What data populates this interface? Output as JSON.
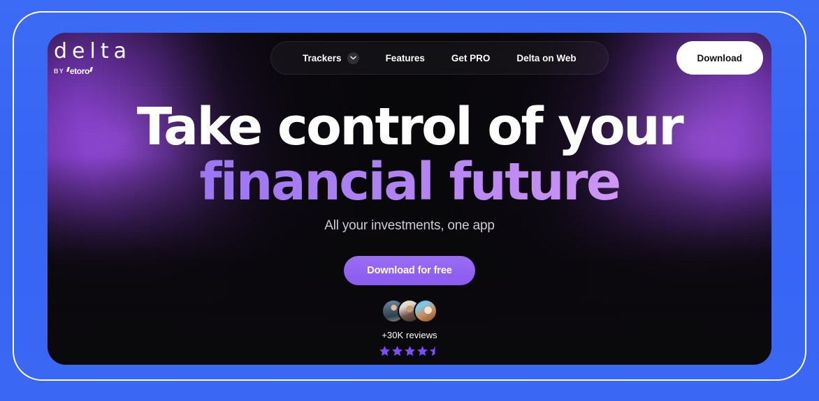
{
  "brand": {
    "logo_word": "delta",
    "logo_by": "BY",
    "logo_parent": "etoro"
  },
  "nav": {
    "items": [
      {
        "label": "Trackers",
        "has_dropdown": true,
        "icon": "chevron-down-icon"
      },
      {
        "label": "Features",
        "has_dropdown": false
      },
      {
        "label": "Get PRO",
        "has_dropdown": false
      },
      {
        "label": "Delta on Web",
        "has_dropdown": false
      }
    ],
    "download_label": "Download"
  },
  "hero": {
    "headline_line1": "Take control of your",
    "headline_line2": "financial future",
    "subtitle": "All your investments, one app",
    "cta_label": "Download for free"
  },
  "social_proof": {
    "reviews_label": "+30K reviews",
    "rating": 4.5,
    "stars_total": 5,
    "avatar_count": 3
  },
  "colors": {
    "page_background": "#3665F3",
    "card_background": "#0B0A0D",
    "glow_purple": "#A855F7",
    "cta_purple": "#8A5BEF",
    "gradient_start": "#8B6FEF",
    "gradient_end": "#E3AAF1",
    "star_purple": "#7C4DFF",
    "frame_outline": "#FFFFFF"
  }
}
